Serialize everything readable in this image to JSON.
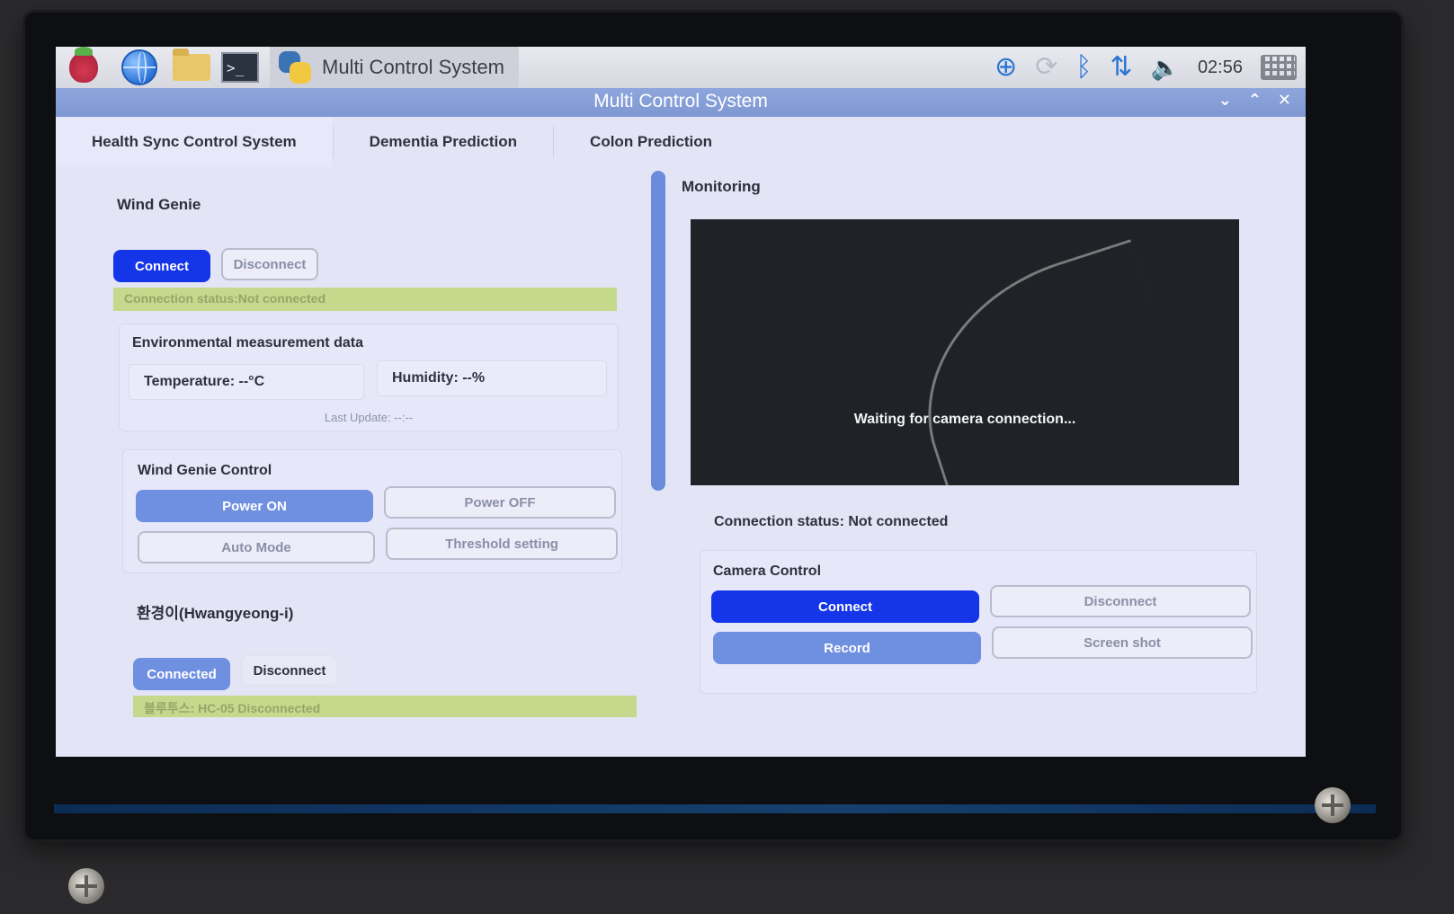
{
  "taskbar": {
    "task_title": "Multi Control System",
    "clock": "02:56",
    "icons": [
      "raspberry-menu-icon",
      "web-browser-icon",
      "file-manager-icon",
      "terminal-icon",
      "python-icon",
      "download-icon",
      "sync-icon",
      "bluetooth-icon",
      "network-icon",
      "volume-icon",
      "keyboard-icon"
    ]
  },
  "window": {
    "title": "Multi Control System",
    "controls": [
      "⌄",
      "⌃",
      "✕"
    ]
  },
  "tabs": [
    "Health Sync Control System",
    "Dementia Prediction",
    "Colon Prediction"
  ],
  "wind_genie": {
    "title": "Wind Genie",
    "connect": "Connect",
    "disconnect": "Disconnect",
    "status": "Connection status:Not connected",
    "env_title": "Environmental measurement data",
    "temperature": "Temperature: --°C",
    "humidity": "Humidity: --%",
    "last_update": "Last Update: --:--",
    "control_title": "Wind Genie Control",
    "power_on": "Power ON",
    "power_off": "Power OFF",
    "auto_mode": "Auto Mode",
    "threshold": "Threshold setting"
  },
  "hwangyeong": {
    "title": "환경이(Hwangyeong-i)",
    "connected": "Connected",
    "disconnect": "Disconnect",
    "status": "블루투스: HC-05 Disconnected"
  },
  "monitoring": {
    "title": "Monitoring",
    "video_message": "Waiting for camera connection...",
    "status": "Connection status: Not connected",
    "camera_title": "Camera Control",
    "connect": "Connect",
    "disconnect": "Disconnect",
    "record": "Record",
    "screenshot": "Screen shot"
  },
  "colors": {
    "accent": "#1535e8",
    "secondary_blue": "#6f8fe0",
    "status_bar": "#c5d98c",
    "titlebar": "#8ea6dc"
  }
}
